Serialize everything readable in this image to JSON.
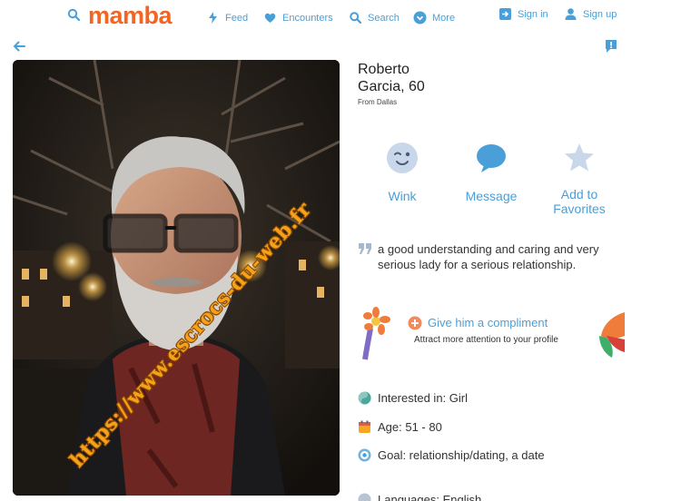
{
  "header": {
    "logo": "mamba",
    "nav": {
      "feed": "Feed",
      "encounters": "Encounters",
      "search": "Search",
      "more": "More",
      "sign_in": "Sign in",
      "sign_up": "Sign up"
    }
  },
  "profile": {
    "first_name": "Roberto",
    "last_name_age": "Garcia, 60",
    "from": "From Dallas",
    "actions": {
      "wink": "Wink",
      "message": "Message",
      "favorites_line1": "Add to",
      "favorites_line2": "Favorites"
    },
    "about": "a good understanding and caring and very serious lady for a serious relationship.",
    "compliment": {
      "title": "Give him a compliment",
      "subtitle": "Attract more attention to your profile"
    },
    "details": {
      "interested_in": "Interested in: Girl",
      "age": "Age: 51 - 80",
      "goal": "Goal: relationship/dating, a date",
      "languages": "Languages: English"
    }
  },
  "photo": {
    "watermark": "https://www.escrocs-du-web.fr"
  },
  "colors": {
    "accent": "#4a9fd8",
    "brand": "#f26522",
    "watermark": "#f7a11a"
  }
}
